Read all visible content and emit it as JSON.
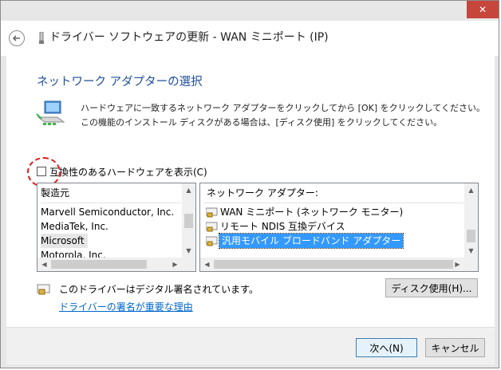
{
  "window": {
    "title": "ドライバー ソフトウェアの更新 - WAN ミニポート (IP)",
    "close_glyph": "✕"
  },
  "page": {
    "heading": "ネットワーク アダプターの選択",
    "description": "ハードウェアに一致するネットワーク アダプターをクリックしてから [OK] をクリックしてください。この機能のインストール ディスクがある場合は、[ディスク使用] をクリックしてください。"
  },
  "compat": {
    "label": "互換性のあるハードウェアを表示(C)",
    "checked": false
  },
  "manufacturers": {
    "header": "製造元",
    "items": [
      "Marvell Semiconductor, Inc.",
      "MediaTek, Inc.",
      "Microsoft",
      "Motorola, Inc."
    ],
    "selected": "Microsoft"
  },
  "adapters": {
    "header": "ネットワーク アダプター:",
    "items": [
      "WAN ミニポート (ネットワーク モニター)",
      "リモート NDIS 互換デバイス",
      "汎用モバイル ブロードバンド アダプター"
    ],
    "selected": "汎用モバイル ブロードバンド アダプター"
  },
  "signature": {
    "text": "このドライバーはデジタル署名されています。",
    "link": "ドライバーの署名が重要な理由"
  },
  "buttons": {
    "disk": "ディスク使用(H)...",
    "next": "次へ(N)",
    "cancel": "キャンセル"
  },
  "colors": {
    "heading": "#1f4e9b",
    "selection": "#3399ff",
    "close": "#c7463b",
    "link": "#0066cc",
    "highlight": "#e11919"
  }
}
